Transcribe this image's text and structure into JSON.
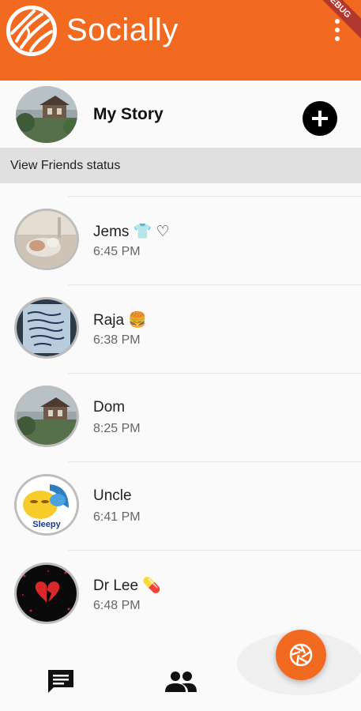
{
  "appbar": {
    "title": "Socially",
    "debug_ribbon": "DEBUG",
    "logo_icon": "socially-logo-icon",
    "menu_icon": "more-vert-icon"
  },
  "my_story": {
    "label": "My Story",
    "add_icon": "add-circle-icon"
  },
  "section": {
    "label": "View Friends status"
  },
  "friends": [
    {
      "name": "Jems 👕 ♡",
      "time": "6:45 PM"
    },
    {
      "name": "Raja 🍔",
      "time": "6:38 PM"
    },
    {
      "name": "Dom",
      "time": "8:25 PM"
    },
    {
      "name": "Uncle",
      "time": "6:41 PM"
    },
    {
      "name": "Dr Lee 💊",
      "time": "6:48 PM"
    }
  ],
  "avatar_captions": {
    "uncle": "Sleepy"
  },
  "bottom_nav": {
    "chat_icon": "chat-icon",
    "people_icon": "people-icon",
    "camera_icon": "camera-shutter-icon"
  },
  "colors": {
    "primary": "#f26a1f",
    "section_bg": "#e0e0e0"
  }
}
